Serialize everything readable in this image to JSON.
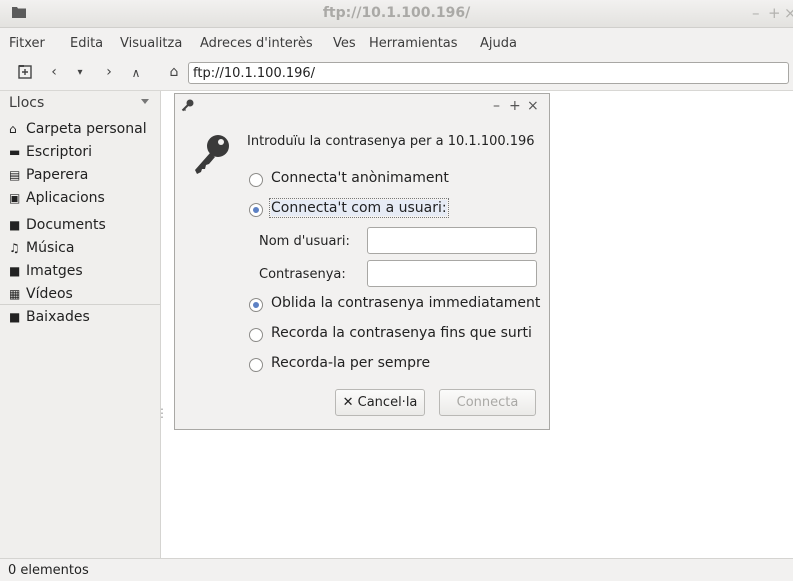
{
  "window": {
    "title": "ftp://10.1.100.196/",
    "minimize": "–",
    "maximize": "+",
    "close": "×"
  },
  "menu": [
    "Fitxer",
    "Edita",
    "Visualitza",
    "Adreces d'interès",
    "Ves",
    "Herramientas",
    "Ajuda"
  ],
  "toolbar": {
    "address": "ftp://10.1.100.196/",
    "icons": [
      "new-tab-icon",
      "back-icon",
      "dropdown-icon",
      "forward-icon",
      "up-icon",
      "home-icon"
    ]
  },
  "sidebar": {
    "header": "Llocs",
    "items": [
      {
        "label": "Carpeta personal",
        "icon": "home-icon"
      },
      {
        "label": "Escriptori",
        "icon": "desktop-icon"
      },
      {
        "label": "Paperera",
        "icon": "trash-icon"
      },
      {
        "label": "Aplicacions",
        "icon": "applications-icon"
      },
      {
        "label": "Documents",
        "icon": "folder-icon"
      },
      {
        "label": "Música",
        "icon": "music-icon"
      },
      {
        "label": "Imatges",
        "icon": "folder-icon"
      },
      {
        "label": "Vídeos",
        "icon": "video-icon"
      },
      {
        "label": "Baixades",
        "icon": "folder-icon"
      }
    ]
  },
  "status": {
    "text": "0 elementos"
  },
  "dialog": {
    "minimize": "–",
    "maximize": "+",
    "close": "×",
    "prompt": "Introduïu la contrasenya per a 10.1.100.196",
    "anonymous": "Connecta't anònimament",
    "as_user": "Connecta't com a usuari:",
    "username_label": "Nom d'usuari:",
    "password_label": "Contrasenya:",
    "username_value": "",
    "password_value": "",
    "forget": "Oblida la contrasenya immediatament",
    "remember_session": "Recorda la contrasenya fins que surti",
    "remember_forever": "Recorda-la per sempre",
    "cancel": "Cancel·la",
    "connect": "Connecta"
  },
  "colors": {
    "radio_selected": "#5d81c4",
    "disabled_text": "#a9a8a5"
  }
}
